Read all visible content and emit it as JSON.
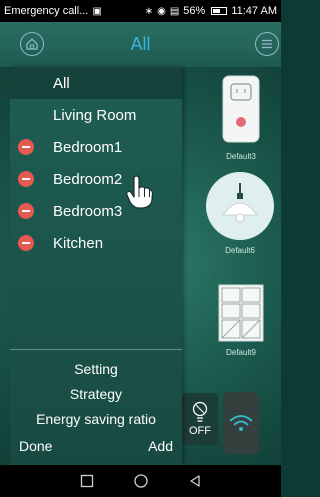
{
  "status_bar": {
    "notification_text": "Emergency call...",
    "battery": "56%",
    "time": "11:47 AM"
  },
  "header": {
    "title": "All"
  },
  "devices": [
    {
      "label": "Default3"
    },
    {
      "label": "Default6"
    },
    {
      "label": "Default9"
    }
  ],
  "controls": {
    "off_label": "OFF"
  },
  "drawer": {
    "rooms": [
      {
        "label": "All",
        "removable": false,
        "selected": true
      },
      {
        "label": "Living Room",
        "removable": false,
        "selected": false
      },
      {
        "label": "Bedroom1",
        "removable": true,
        "selected": false
      },
      {
        "label": "Bedroom2",
        "removable": true,
        "selected": false
      },
      {
        "label": "Bedroom3",
        "removable": true,
        "selected": false
      },
      {
        "label": "Kitchen",
        "removable": true,
        "selected": false
      }
    ],
    "menu": {
      "setting": "Setting",
      "strategy": "Strategy",
      "energy": "Energy saving ratio"
    },
    "done_label": "Done",
    "add_label": "Add"
  },
  "colors": {
    "accent": "#39b4e0",
    "remove": "#e45a4f",
    "drawer_bg": "#1f5e54"
  },
  "icons": [
    "home-icon",
    "menu-icon",
    "socket-icon",
    "lamp-icon",
    "switch-panel-icon",
    "bulb-icon",
    "wifi-icon",
    "hand-cursor-icon",
    "back-icon",
    "home-nav-icon",
    "recents-icon"
  ]
}
